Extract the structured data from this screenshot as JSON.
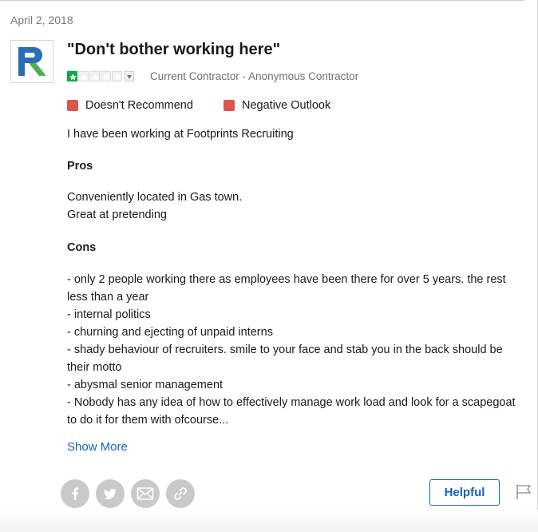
{
  "review": {
    "date": "April 2, 2018",
    "title": "\"Don't bother working here\"",
    "rating": 1,
    "rating_max": 5,
    "author": "Current Contractor - Anonymous Contractor",
    "indicators": [
      {
        "label": "Doesn't Recommend",
        "color": "#e2534d"
      },
      {
        "label": "Negative Outlook",
        "color": "#e2534d"
      }
    ],
    "summary": "I have been working at Footprints Recruiting",
    "pros_heading": "Pros",
    "pros_lines": [
      "Conveniently located in Gas town.",
      "Great at pretending"
    ],
    "cons_heading": "Cons",
    "cons_lines": [
      "- only 2 people working there as employees have been there for over 5 years. the rest",
      "less than a year",
      "- internal politics",
      "- churning and ejecting of unpaid interns",
      "- shady behaviour of recruiters. smile to your face and stab you in the back should be",
      "their motto",
      "- abysmal senior management",
      "- Nobody has any idea of how to effectively manage work load and look for a scapegoat",
      "to do it for them with ofcourse..."
    ],
    "show_more": "Show More"
  },
  "company_logo": {
    "icon": "company-logo-icon",
    "colors": [
      "#2a6db5",
      "#4caf50"
    ]
  },
  "share": [
    "facebook-icon",
    "twitter-icon",
    "email-icon",
    "link-icon"
  ],
  "actions": {
    "helpful_label": "Helpful",
    "flag_icon": "flag-icon"
  },
  "colors": {
    "accent": "#1861bf",
    "star": "#0caa41",
    "negative": "#e2534d"
  }
}
